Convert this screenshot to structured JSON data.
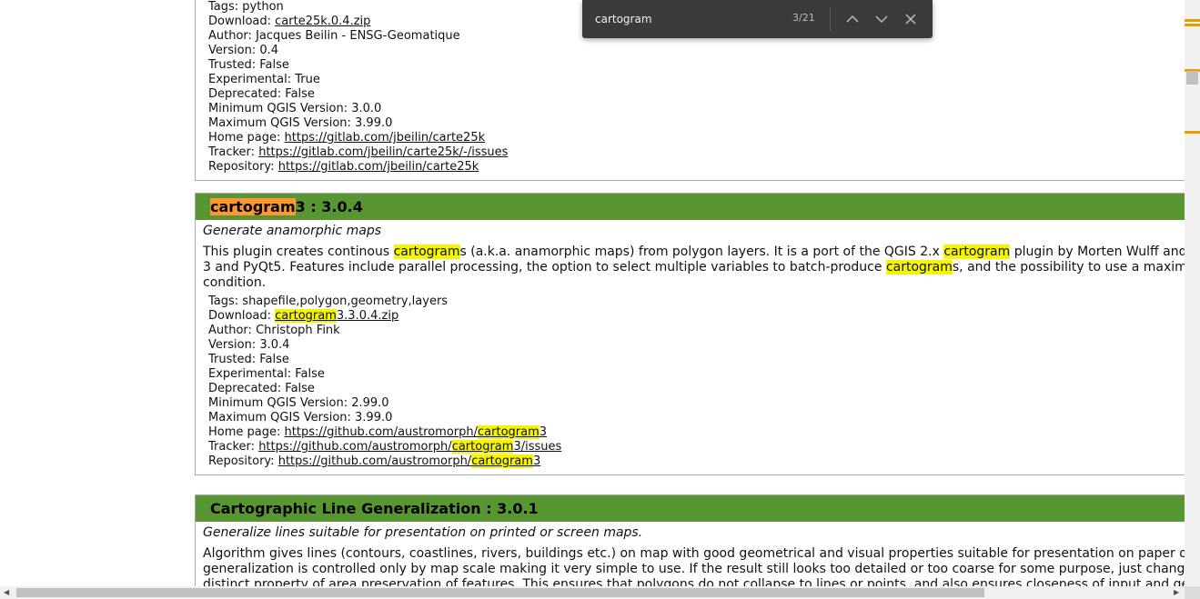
{
  "find": {
    "query": "cartogram",
    "count": "3/21"
  },
  "plugins": [
    {
      "meta_tail": [
        {
          "label": "Tags:",
          "value": "python"
        },
        {
          "label": "Download:",
          "link": "carte25k.0.4.zip"
        },
        {
          "label": "Author:",
          "value": "Jacques Beilin - ENSG-Geomatique"
        },
        {
          "label": "Version:",
          "value": "0.4"
        },
        {
          "label": "Trusted:",
          "value": "False"
        },
        {
          "label": "Experimental:",
          "value": "True"
        },
        {
          "label": "Deprecated:",
          "value": "False"
        },
        {
          "label": "Minimum QGIS Version:",
          "value": "3.0.0"
        },
        {
          "label": "Maximum QGIS Version:",
          "value": "3.99.0"
        },
        {
          "label": "Home page:",
          "link": "https://gitlab.com/jbeilin/carte25k"
        },
        {
          "label": "Tracker:",
          "link": "https://gitlab.com/jbeilin/carte25k/-/issues"
        },
        {
          "label": "Repository:",
          "link": "https://gitlab.com/jbeilin/carte25k"
        }
      ]
    },
    {
      "title_hl": "cartogram",
      "title_rest": "3 : 3.0.4",
      "description": "Generate anamorphic maps",
      "about_lines": [
        [
          "This plugin creates continous ",
          "#cartogram",
          "s (a.k.a. anamorphic maps) from polygon layers. It is a port of the QGIS 2.x ",
          "#cartogram",
          " plugin by Morten Wulff and Ca"
        ],
        [
          "3 and PyQt5. Features include parallel processing, the option to select multiple variables to batch-produce ",
          "#cartogram",
          "s, and the possibility to use a maximum"
        ],
        [
          "condition."
        ]
      ],
      "tags": "shapefile,polygon,geometry,layers",
      "download": [
        "#cartogram",
        "3.3.0.4.zip"
      ],
      "author": "Christoph Fink",
      "version": "3.0.4",
      "trusted": "False",
      "experimental": "False",
      "deprecated": "False",
      "min_qgis": "2.99.0",
      "max_qgis": "3.99.0",
      "home": [
        "https://github.com/austromorph/",
        "#cartogram",
        "3"
      ],
      "tracker": [
        "https://github.com/austromorph/",
        "#cartogram",
        "3/issues"
      ],
      "repository": [
        "https://github.com/austromorph/",
        "#cartogram",
        "3"
      ],
      "labels": {
        "tags": "Tags:",
        "download": "Download:",
        "author": "Author:",
        "version": "Version:",
        "trusted": "Trusted:",
        "experimental": "Experimental:",
        "deprecated": "Deprecated:",
        "min_qgis": "Minimum QGIS Version:",
        "max_qgis": "Maximum QGIS Version:",
        "home": "Home page:",
        "tracker": "Tracker:",
        "repository": "Repository:"
      }
    },
    {
      "title": "Cartographic Line Generalization : 3.0.1",
      "description": "Generalize lines suitable for presentation on printed or screen maps.",
      "about_lines": [
        "Algorithm gives lines (contours, coastlines, rivers, buildings etc.) on map with good geometrical and visual properties suitable for presentation on paper or sc",
        "generalization is controlled only by map scale making it very simple to use. If the result still looks too detailed or too coarse for some purpose, just change th",
        "distinct property of area preservation of features. This ensures that polygons do not collapse to lines or points, and also ensures closeness of input and gener"
      ]
    }
  ],
  "colors": {
    "header_green": "#589632",
    "highlight": "#f5f500",
    "current_highlight": "#ff9632",
    "findbar_bg": "#3b3b3b",
    "scroll_mark": "#e8a000"
  },
  "icons": {
    "prev": "chevron-up-icon",
    "next": "chevron-down-icon",
    "close": "close-icon"
  }
}
